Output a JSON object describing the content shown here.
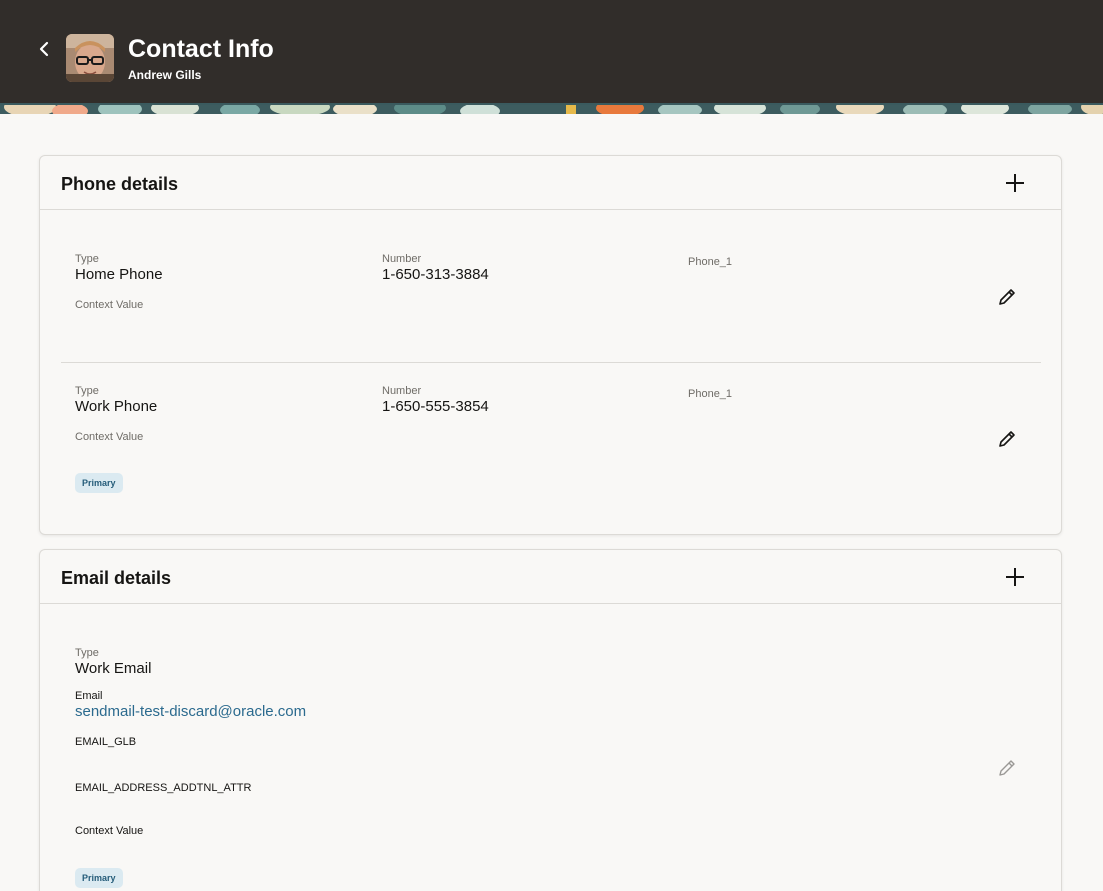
{
  "header": {
    "title": "Contact Info",
    "subtitle": "Andrew Gills",
    "back_icon": "chevron-left-icon",
    "background_color": "#312d2a"
  },
  "phone_section": {
    "title": "Phone details",
    "add_icon": "plus-icon",
    "items": [
      {
        "type_label": "Type",
        "type_value": "Home Phone",
        "number_label": "Number",
        "number_value": "1-650-313-3884",
        "extra_label": "Phone_1",
        "context_label": "Context Value",
        "badge": ""
      },
      {
        "type_label": "Type",
        "type_value": "Work Phone",
        "number_label": "Number",
        "number_value": "1-650-555-3854",
        "extra_label": "Phone_1",
        "context_label": "Context Value",
        "badge": "Primary"
      }
    ]
  },
  "email_section": {
    "title": "Email details",
    "add_icon": "plus-icon",
    "items": [
      {
        "type_label": "Type",
        "type_value": "Work Email",
        "email_label": "Email",
        "email_value": "sendmail-test-discard@oracle.com",
        "attr1_label": "EMAIL_GLB",
        "attr2_label": "EMAIL_ADDRESS_ADDTNL_ATTR",
        "context_label": "Context Value",
        "badge": "Primary"
      }
    ]
  },
  "colors": {
    "link": "#2b6a8e",
    "badge_bg": "#dbeaf1",
    "badge_text": "#265d7a",
    "page_bg": "#f9f8f6"
  }
}
